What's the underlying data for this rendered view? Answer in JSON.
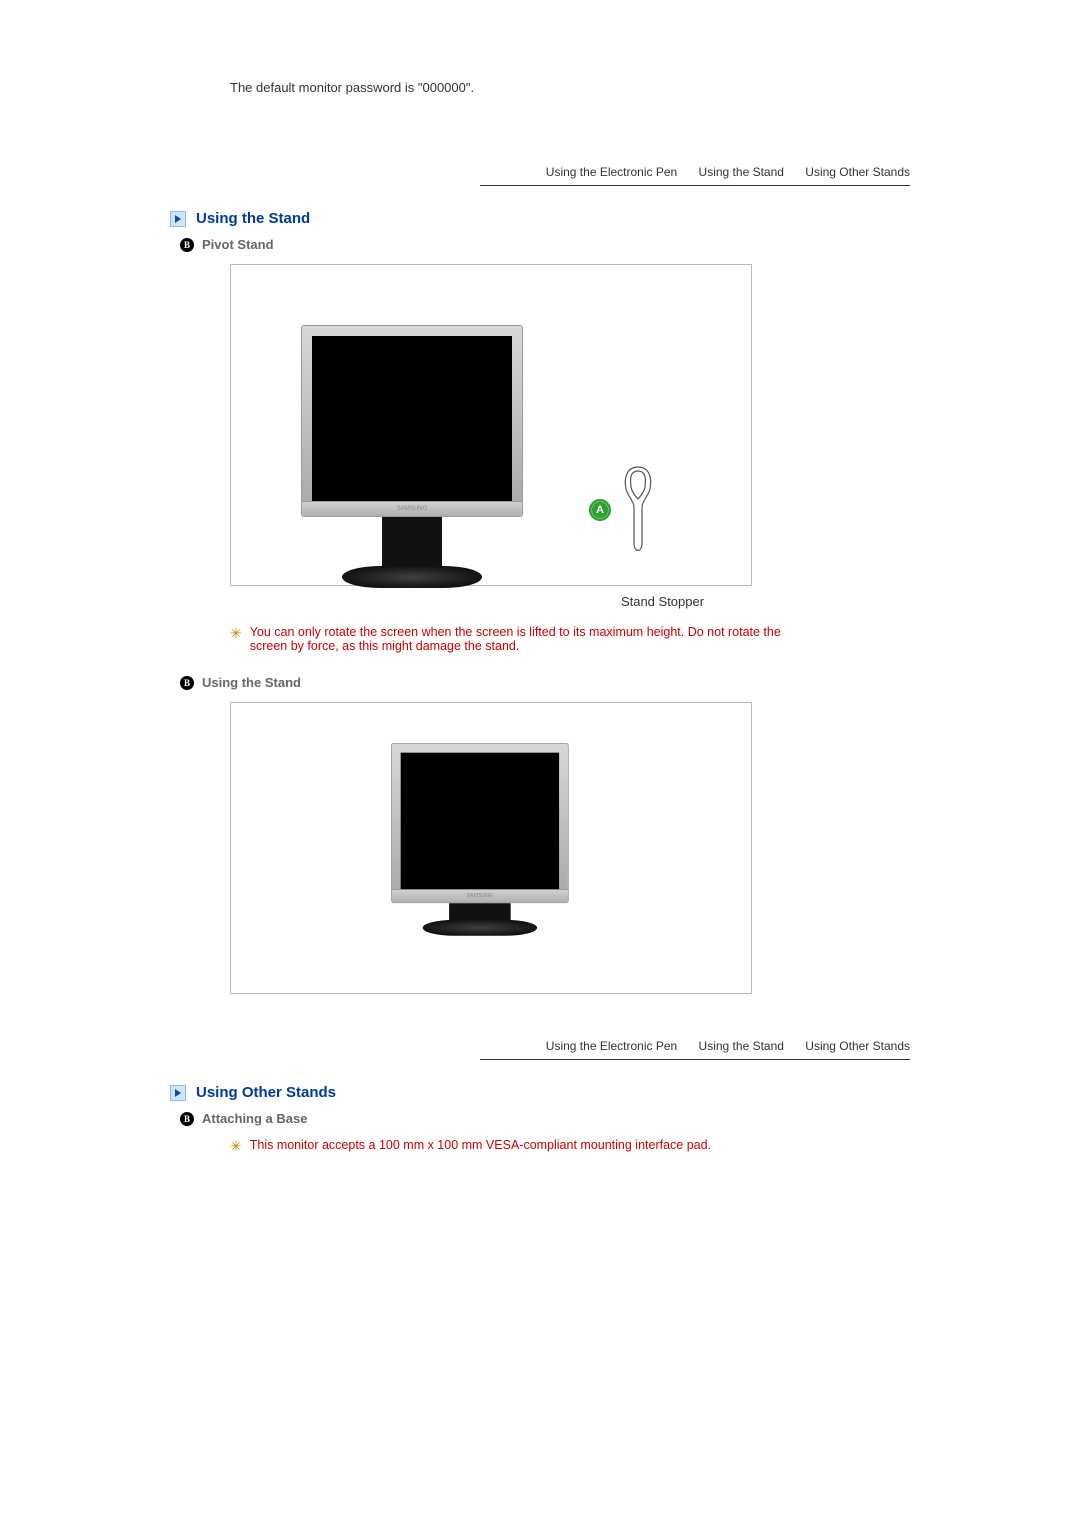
{
  "intro_text": "The default monitor password is \"000000\".",
  "tabs": {
    "electronic_pen": "Using the Electronic Pen",
    "stand": "Using the Stand",
    "other_stands": "Using Other Stands"
  },
  "section1": {
    "heading": "Using the Stand",
    "sub_pivot": "Pivot Stand",
    "marker_a_label": "A",
    "caption": "Stand Stopper",
    "note": "You can only rotate the screen when the screen is lifted to its maximum height. Do not rotate the screen by force, as this might damage the stand.",
    "sub_using": "Using the Stand"
  },
  "section2": {
    "heading": "Using Other Stands",
    "sub_attach": "Attaching a Base",
    "note": "This monitor accepts a 100 mm x 100 mm VESA-compliant mounting interface pad."
  },
  "bullet_letter": "B"
}
